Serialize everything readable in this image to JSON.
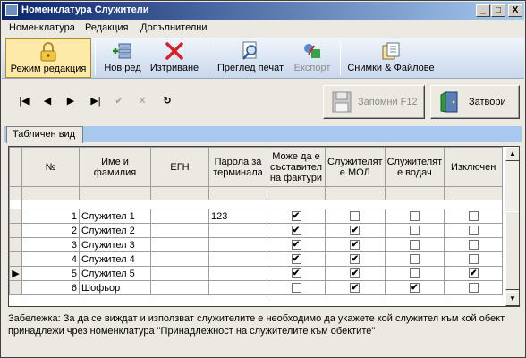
{
  "window": {
    "title": "Номенклатура Служители"
  },
  "titlebar_buttons": {
    "minimize": "_",
    "maximize": "□",
    "close": "X"
  },
  "menu": [
    "Номенклатура",
    "Редакция",
    "Допълнителни"
  ],
  "toolbar": {
    "edit_mode": "Режим редакция",
    "new_row": "Нов ред",
    "delete": "Изтриване",
    "print_preview": "Преглед печат",
    "export": "Експорт",
    "files": "Снимки & Файлове"
  },
  "nav": {
    "first": "|◀",
    "prev": "◀",
    "next": "▶",
    "last": "▶|",
    "confirm": "✔",
    "cancel": "✕",
    "refresh": "↻"
  },
  "buttons": {
    "save": "Запомни  F12",
    "close": "Затвори"
  },
  "tab": {
    "label": "Табличен вид"
  },
  "table": {
    "columns": [
      "№",
      "Име и фамилия",
      "ЕГН",
      "Парола за терминала",
      "Може да е съставител на фактури",
      "Служителят е МОЛ",
      "Служителят е водач",
      "Изключен"
    ],
    "rows": [
      {
        "num": "1",
        "name": "Служител 1",
        "egn": "",
        "password": "123",
        "invoice": true,
        "mol": false,
        "driver": false,
        "excluded": false
      },
      {
        "num": "2",
        "name": "Служител 2",
        "egn": "",
        "password": "",
        "invoice": true,
        "mol": true,
        "driver": false,
        "excluded": false
      },
      {
        "num": "3",
        "name": "Служител 3",
        "egn": "",
        "password": "",
        "invoice": true,
        "mol": true,
        "driver": false,
        "excluded": false
      },
      {
        "num": "4",
        "name": "Служител 4",
        "egn": "",
        "password": "",
        "invoice": true,
        "mol": true,
        "driver": false,
        "excluded": false
      },
      {
        "num": "5",
        "name": "Служител 5",
        "egn": "",
        "password": "",
        "invoice": true,
        "mol": true,
        "driver": false,
        "excluded": true
      },
      {
        "num": "6",
        "name": "Шофьор",
        "egn": "",
        "password": "",
        "invoice": false,
        "mol": true,
        "driver": true,
        "excluded": false
      }
    ],
    "current_row_marker": "▶",
    "check_mark": "✔"
  },
  "note": "Забележка: За да се виждат и използват служителите е необходимо да укажете кой служител към кой обект принадлежи чрез номенклатура \"Принадлежност на служителите към обектите\""
}
